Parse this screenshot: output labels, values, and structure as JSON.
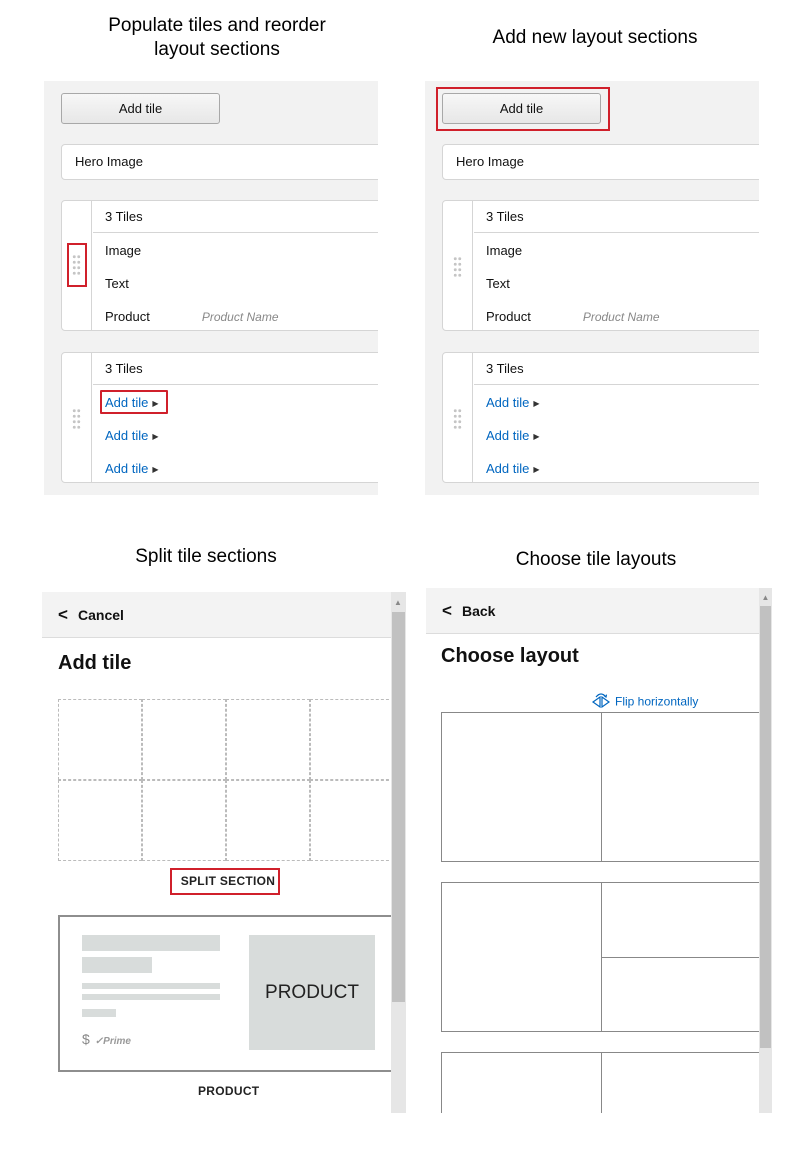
{
  "captions": {
    "top_left": "Populate tiles and reorder\nlayout sections",
    "top_right": "Add new layout sections",
    "bottom_left": "Split tile sections",
    "bottom_right": "Choose tile layouts"
  },
  "editor": {
    "add_tile_button": "Add tile",
    "hero": "Hero Image",
    "section_a": {
      "title": "3 Tiles",
      "rows": [
        "Image",
        "Text",
        "Product"
      ],
      "product_placeholder": "Product Name"
    },
    "section_b": {
      "title": "3 Tiles",
      "links": [
        "Add tile",
        "Add tile",
        "Add tile"
      ]
    }
  },
  "add_tile_panel": {
    "back_label": "Cancel",
    "title": "Add tile",
    "split_label": "SPLIT SECTION",
    "product_card_text": "PRODUCT",
    "price_symbol": "$",
    "prime_label": "✓Prime",
    "product_label": "PRODUCT"
  },
  "layout_panel": {
    "back_label": "Back",
    "title": "Choose layout",
    "flip_label": "Flip horizontally"
  },
  "colors": {
    "highlight": "#d0202b",
    "link": "#0066c0"
  }
}
